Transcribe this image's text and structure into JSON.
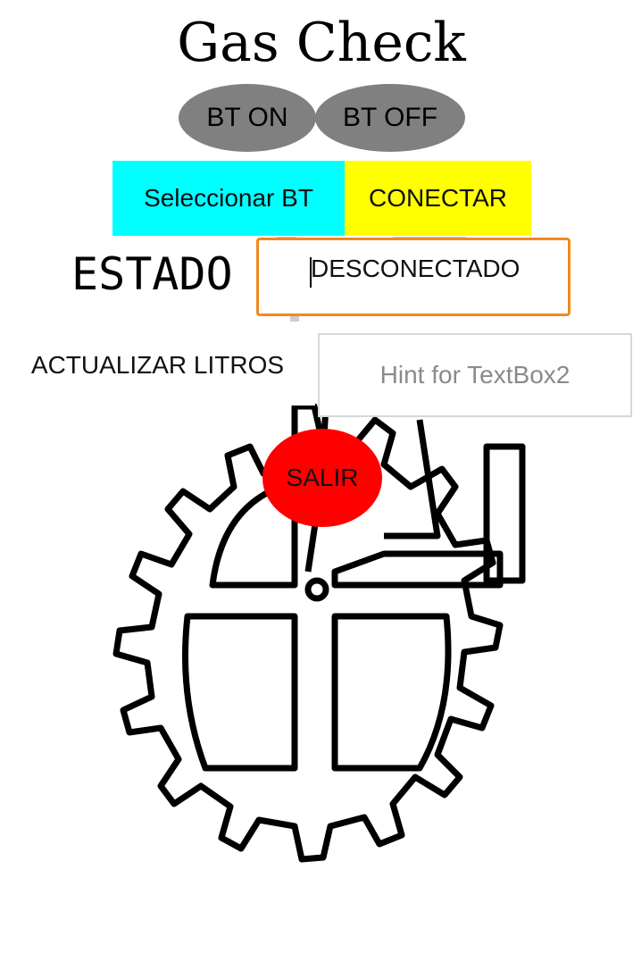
{
  "app": {
    "title": "Gas Check"
  },
  "bluetooth": {
    "on_label": "BT ON",
    "off_label": "BT OFF",
    "select_label": "Seleccionar BT",
    "connect_label": "CONECTAR"
  },
  "status": {
    "label": "ESTADO",
    "value": "DESCONECTADO"
  },
  "liters": {
    "update_label": "ACTUALIZAR LITROS",
    "input_value": "",
    "input_placeholder": "Hint for TextBox2"
  },
  "exit": {
    "label": "SALIR"
  },
  "colors": {
    "bt_buttons": "#808080",
    "select_bt": "#00ffff",
    "connect": "#ffff00",
    "status_border": "#f0891e",
    "exit": "#ff0000"
  },
  "background": {
    "icon": "gear-emblem-logo"
  }
}
